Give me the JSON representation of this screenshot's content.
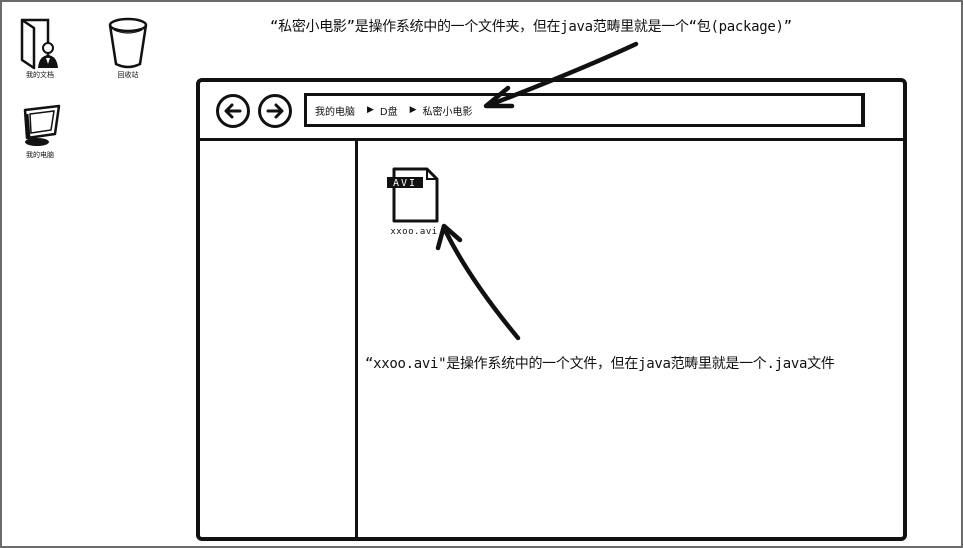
{
  "desktop": {
    "icons": [
      {
        "label": "我的文档",
        "icon": "documents-user-icon"
      },
      {
        "label": "回收站",
        "icon": "recycle-bin-icon"
      },
      {
        "label": "我的电脑",
        "icon": "computer-icon"
      }
    ]
  },
  "annotations": {
    "top": "“私密小电影”是操作系统中的一个文件夹，但在java范畴里就是一个“包(package)”",
    "bottom": "“xxoo.avi\"是操作系统中的一个文件，但在java范畴里就是一个.java文件"
  },
  "window": {
    "back_icon": "arrow-left-icon",
    "forward_icon": "arrow-right-icon",
    "breadcrumb": [
      "我的电脑",
      "D盘",
      "私密小电影"
    ],
    "file": {
      "badge": "AVI",
      "name": "xxoo.avi"
    }
  }
}
